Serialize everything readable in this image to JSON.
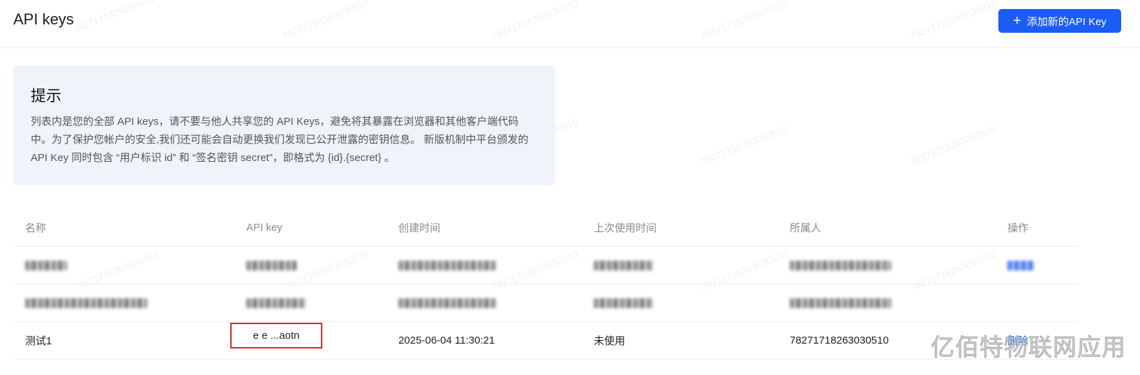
{
  "header": {
    "title": "API keys",
    "add_button_label": "添加新的API Key"
  },
  "tip": {
    "title": "提示",
    "lines": [
      "列表内是您的全部 API keys，请不要与他人共享您的 API Keys，避免将其暴露在浏览器和其他客户端代码",
      "中。为了保护您帐户的安全,我们还可能会自动更换我们发现已公开泄露的密钥信息。 新版机制中平台颁发的",
      "API Key 同时包含 “用户标识 id” 和 “签名密钥 secret”，即格式为 {id}.{secret} 。"
    ]
  },
  "table": {
    "columns": [
      "名称",
      "API key",
      "创建时间",
      "上次使用时间",
      "所属人",
      "操作"
    ],
    "rows": [
      {
        "name": "",
        "api_key": "",
        "created": "",
        "last_used": "",
        "owner": "",
        "action": ""
      },
      {
        "name": "",
        "api_key": "",
        "created": "",
        "last_used": "",
        "owner": "",
        "action": ""
      },
      {
        "name": "测试1",
        "api_key": "e e ...aotn",
        "created": "2025-06-04 11:30:21",
        "last_used": "未使用",
        "owner": "78271718263030510",
        "action": "删除"
      }
    ]
  },
  "watermark": {
    "text": "78271718263030510"
  },
  "brand_watermark": "亿佰特物联网应用",
  "colors": {
    "primary": "#1a5cf5",
    "highlight_border": "#e0202a",
    "tip_background": "#f1f3fa"
  }
}
